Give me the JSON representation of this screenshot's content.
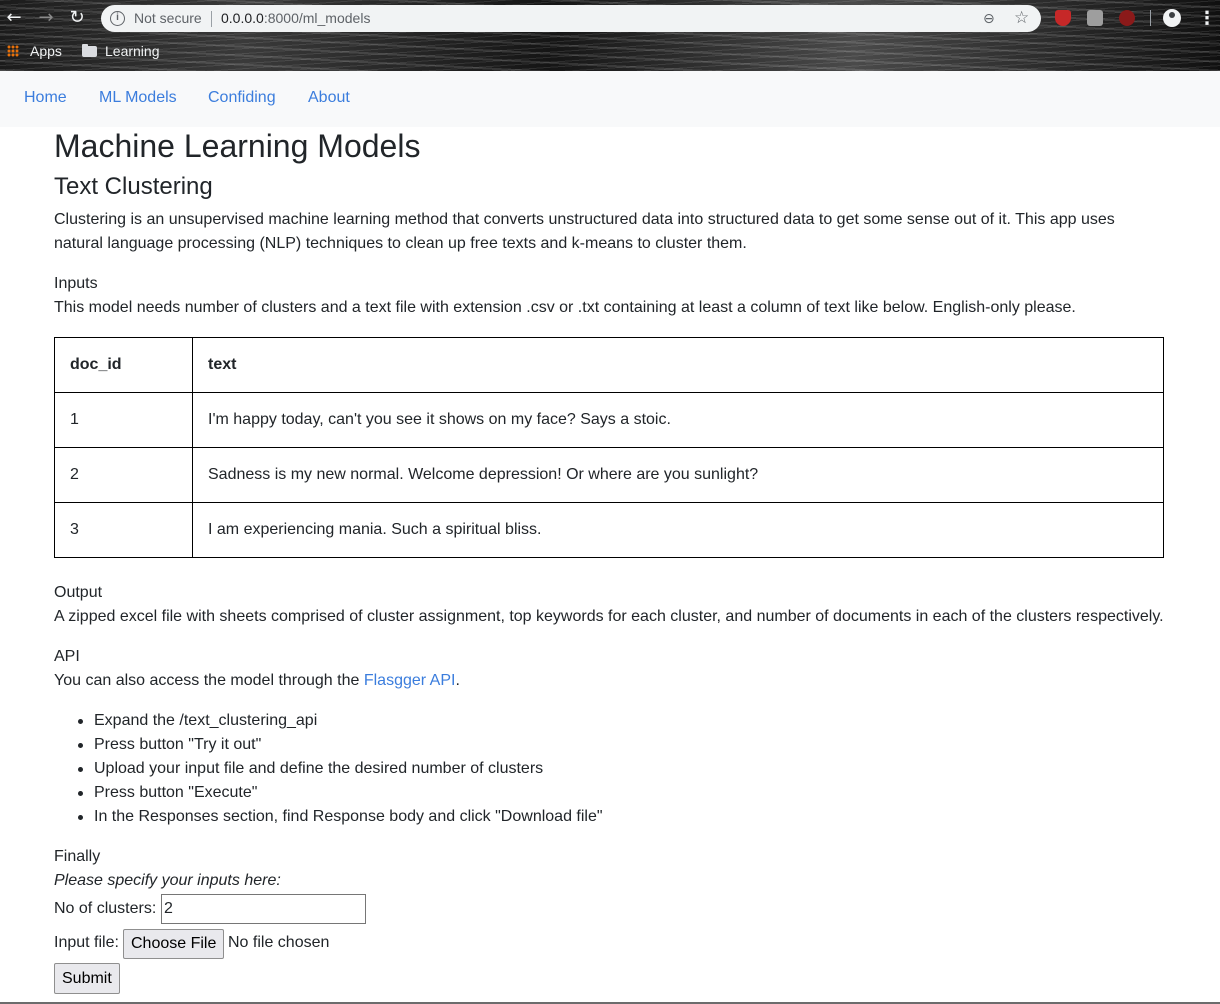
{
  "browser": {
    "back_icon": "←",
    "forward_icon": "→",
    "reload_icon": "↻",
    "security_label": "Not secure",
    "url_host": "0.0.0.0",
    "url_rest": ":8000/ml_models",
    "zoom_icon": "⊖",
    "star_icon": "☆",
    "menu_icon": "⋮",
    "bookmarks": [
      {
        "label": "Apps"
      },
      {
        "label": "Learning"
      }
    ]
  },
  "navbar": {
    "links": [
      {
        "label": "Home"
      },
      {
        "label": "ML Models"
      },
      {
        "label": "Confiding"
      },
      {
        "label": "About"
      }
    ],
    "link_color": "#3b7ddd"
  },
  "main": {
    "title": "Machine Learning Models",
    "section_title": "Text Clustering",
    "intro_line1": "Clustering is an unsupervised machine learning method that converts unstructured data into structured data to get some sense out of it. This app uses",
    "intro_line2": "natural language processing (NLP) techniques to clean up free texts and k-means to cluster them.",
    "inputs_heading": "Inputs",
    "inputs_text": "This model needs number of clusters and a text file with extension .csv or .txt containing at least a column of text like below. English-only please.",
    "table": {
      "headers": [
        "doc_id",
        "text"
      ],
      "rows": [
        [
          "1",
          "I'm happy today, can't you see it shows on my face? Says a stoic."
        ],
        [
          "2",
          "Sadness is my new normal. Welcome depression! Or where are you sunlight?"
        ],
        [
          "3",
          "I am experiencing mania. Such a spiritual bliss."
        ]
      ]
    },
    "output_heading": "Output",
    "output_text": "A zipped excel file with sheets comprised of cluster assignment, top keywords for each cluster, and number of documents in each of the clusters respectively.",
    "api_heading": "API",
    "api_text_before": "You can also access the model through the ",
    "api_link_label": "Flasgger API",
    "api_text_after": ".",
    "steps": [
      "Expand the /text_clustering_api",
      "Press button \"Try it out\"",
      "Upload your input file and define the desired number of clusters",
      "Press button \"Execute\"",
      "In the Responses section, find Response body and click \"Download file\""
    ],
    "finally_heading": "Finally",
    "specify_text": "Please specify your inputs here:",
    "clusters_label": "No of clusters:",
    "clusters_value": "2",
    "file_label": "Input file:",
    "file_button": "Choose File",
    "file_status": "No file chosen",
    "submit_label": "Submit"
  }
}
